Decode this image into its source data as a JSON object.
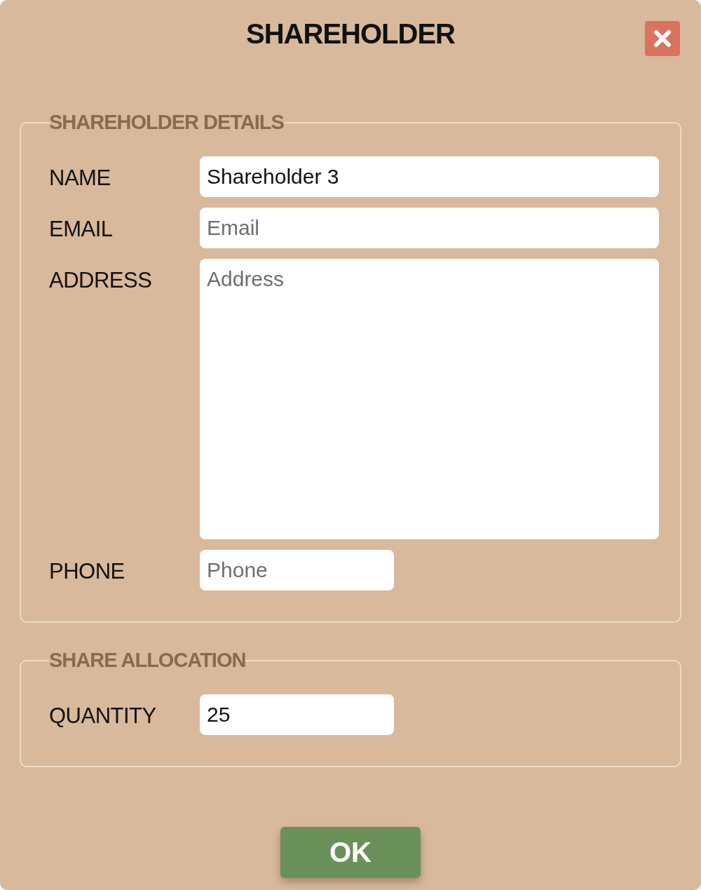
{
  "dialog": {
    "title": "SHAREHOLDER"
  },
  "sections": [
    {
      "legend": "SHAREHOLDER DETAILS",
      "fields": [
        {
          "label": "NAME",
          "kind": "text",
          "value": "Shareholder 3"
        },
        {
          "label": "EMAIL",
          "kind": "text",
          "placeholder": "Email"
        },
        {
          "label": "ADDRESS",
          "kind": "textarea",
          "placeholder": "Address"
        },
        {
          "label": "PHONE",
          "kind": "short",
          "placeholder": "Phone"
        }
      ]
    },
    {
      "legend": "SHARE ALLOCATION",
      "fields": [
        {
          "label": "QUANTITY",
          "kind": "short",
          "value": "25"
        }
      ]
    }
  ],
  "ok_button": "OK"
}
